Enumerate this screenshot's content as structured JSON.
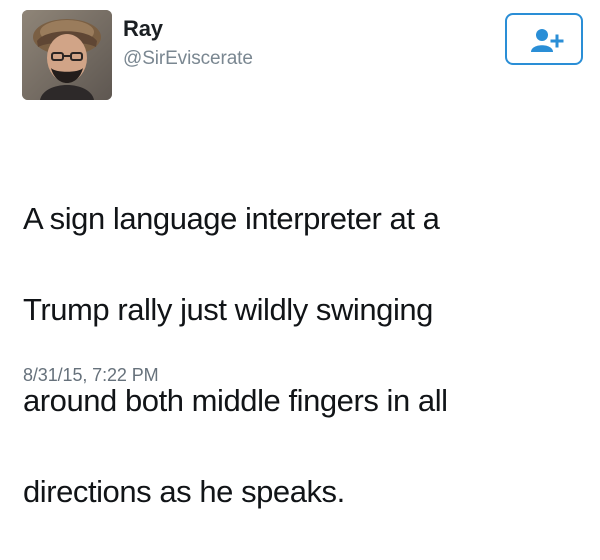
{
  "tweet": {
    "author": {
      "display_name": "Ray",
      "handle": "@SirEviscerate",
      "avatar_icon": "user-avatar-icon"
    },
    "follow_button": {
      "icon": "add-user-icon",
      "color": "#2a8ed6"
    },
    "text_lines": [
      "A sign language interpreter at a",
      "Trump rally just wildly swinging",
      "around both middle fingers in all",
      "directions as he speaks."
    ],
    "timestamp": "8/31/15, 7:22 PM"
  },
  "colors": {
    "background": "#ffffff",
    "handle": "#7a8791",
    "accent": "#2a8ed6",
    "text": "#111417"
  }
}
